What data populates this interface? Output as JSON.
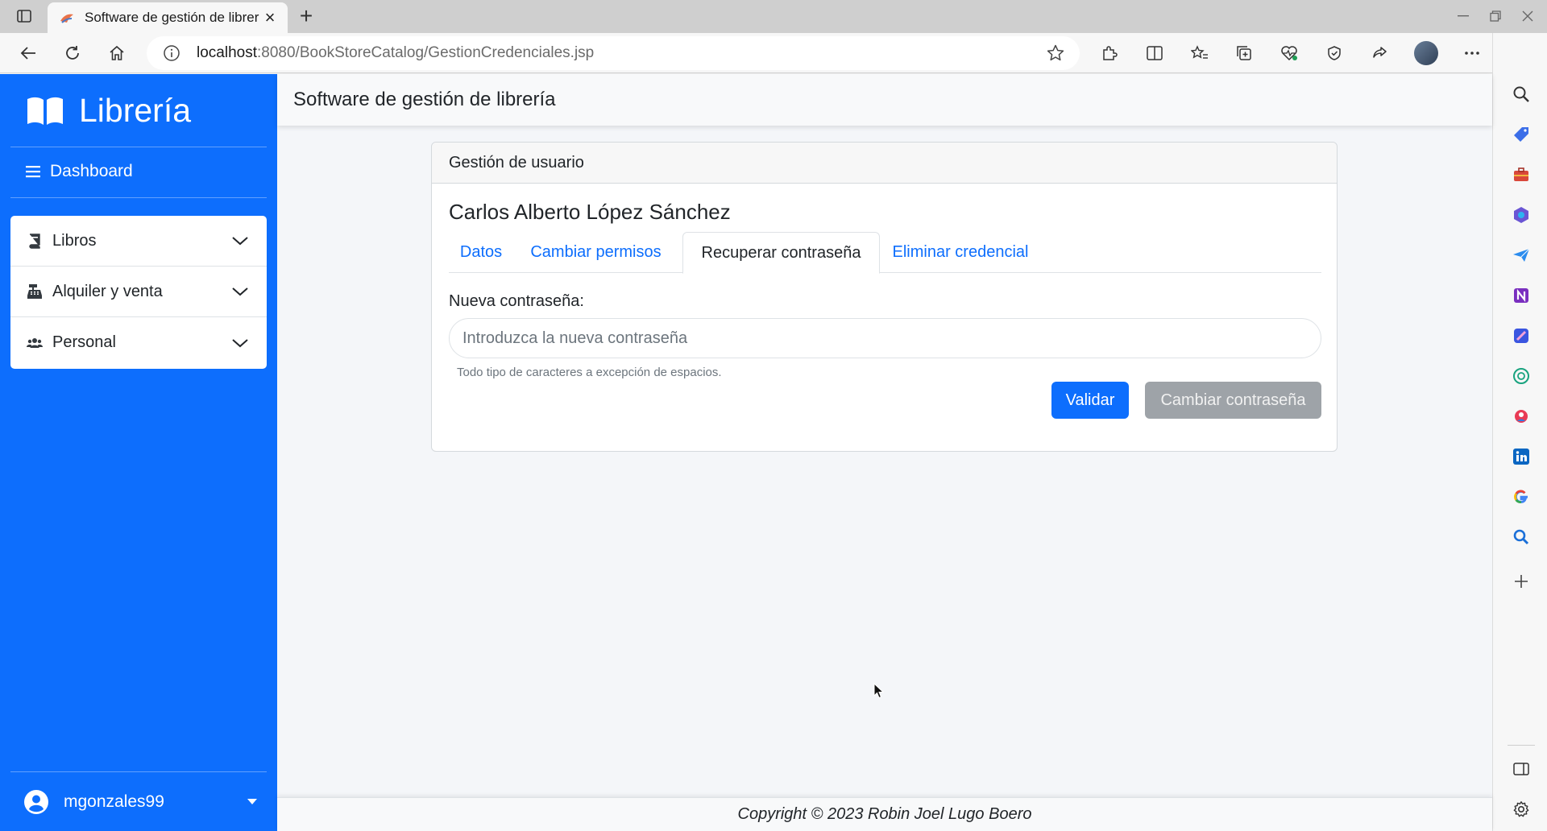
{
  "browser": {
    "tab_title": "Software de gestión de librer",
    "url_host": "localhost",
    "url_path": ":8080/BookStoreCatalog/GestionCredenciales.jsp"
  },
  "sidebar": {
    "brand": "Librería",
    "dashboard_label": "Dashboard",
    "menu": [
      {
        "label": "Libros",
        "icon": "book-icon"
      },
      {
        "label": "Alquiler y venta",
        "icon": "cash-register-icon"
      },
      {
        "label": "Personal",
        "icon": "users-icon"
      }
    ],
    "username": "mgonzales99"
  },
  "topbar": {
    "title": "Software de gestión de librería"
  },
  "card": {
    "header": "Gestión de usuario",
    "user_full_name": "Carlos Alberto López Sánchez",
    "tabs": [
      {
        "label": "Datos",
        "active": false
      },
      {
        "label": "Cambiar permisos",
        "active": false
      },
      {
        "label": "Recuperar contraseña",
        "active": true
      },
      {
        "label": "Eliminar credencial",
        "active": false
      }
    ],
    "password_label": "Nueva contraseña:",
    "password_value": "",
    "password_placeholder": "Introduzca la nueva contraseña",
    "password_hint": "Todo tipo de caracteres a excepción de espacios.",
    "validate_button": "Validar",
    "change_button": "Cambiar contraseña"
  },
  "footer": {
    "copyright": "Copyright © 2023 Robin Joel Lugo Boero"
  },
  "colors": {
    "primary": "#0d6efd",
    "disabled_button": "#9ea3a8"
  }
}
